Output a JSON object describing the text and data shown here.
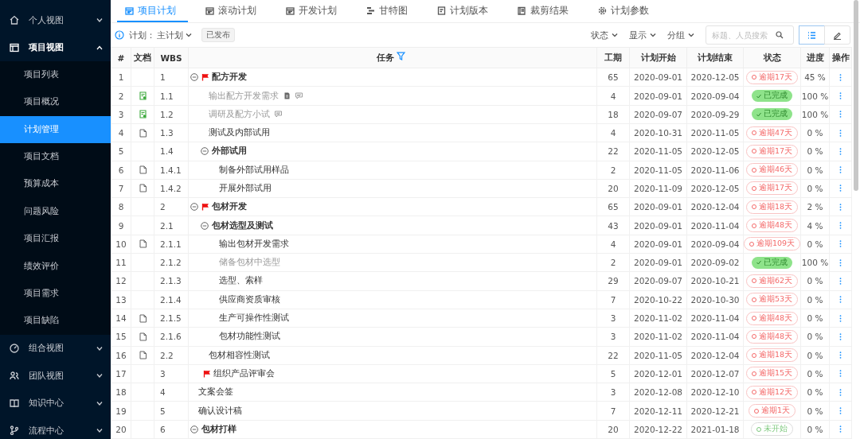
{
  "sidebar": {
    "groups": [
      {
        "label": "个人视图",
        "expanded": false
      },
      {
        "label": "项目视图",
        "expanded": true,
        "items": [
          {
            "label": "项目列表",
            "selected": false
          },
          {
            "label": "项目概况",
            "selected": false
          },
          {
            "label": "计划管理",
            "selected": true
          },
          {
            "label": "项目文档",
            "selected": false
          },
          {
            "label": "预算成本",
            "selected": false
          },
          {
            "label": "问题风险",
            "selected": false
          },
          {
            "label": "项目汇报",
            "selected": false
          },
          {
            "label": "绩效评价",
            "selected": false
          },
          {
            "label": "项目需求",
            "selected": false
          },
          {
            "label": "项目缺陷",
            "selected": false
          }
        ]
      },
      {
        "label": "组合视图",
        "expanded": false
      },
      {
        "label": "团队视图",
        "expanded": false
      },
      {
        "label": "知识中心",
        "expanded": false
      },
      {
        "label": "流程中心",
        "expanded": false
      }
    ]
  },
  "tabs": [
    {
      "label": "项目计划",
      "selected": true
    },
    {
      "label": "滚动计划",
      "selected": false
    },
    {
      "label": "开发计划",
      "selected": false
    },
    {
      "label": "甘特图",
      "selected": false
    },
    {
      "label": "计划版本",
      "selected": false
    },
    {
      "label": "裁剪结果",
      "selected": false
    },
    {
      "label": "计划参数",
      "selected": false
    }
  ],
  "toolbar": {
    "plan_label": "计划：",
    "plan": "主计划",
    "plan_status": "已发布",
    "filters": [
      "状态",
      "显示",
      "分组"
    ],
    "search": {
      "placeholder": "标题、人员搜索"
    },
    "views": [
      {
        "selected": true
      },
      {
        "selected": false
      }
    ]
  },
  "table": {
    "columns": [
      "#",
      "文档",
      "WBS",
      "任务",
      "工期",
      "计划开始",
      "计划结束",
      "状态",
      "进度",
      "操作"
    ],
    "rows": [
      {
        "num": "1",
        "document": false,
        "wbs": "1",
        "task": "配方开发",
        "flag": true,
        "note": false,
        "comment": false,
        "expanded": true,
        "duration": "65",
        "start": "2020-09-01",
        "end": "2020-12-05",
        "status": {
          "kind": "overdue",
          "label": "逾期17天"
        },
        "progress": "45 %",
        "children": [
          {
            "num": "2",
            "document": true,
            "document_checked": true,
            "wbs": "1.1",
            "task": "输出配方开发需求",
            "flag": false,
            "note": true,
            "comment": true,
            "duration": "4",
            "start": "2020-09-01",
            "end": "2020-09-04",
            "status": {
              "kind": "done",
              "label": "已完成"
            },
            "progress": "100 %"
          },
          {
            "num": "3",
            "document": true,
            "document_checked": true,
            "wbs": "1.2",
            "task": "调研及配方小试",
            "flag": false,
            "note": false,
            "comment": true,
            "duration": "18",
            "start": "2020-09-07",
            "end": "2020-09-29",
            "status": {
              "kind": "done",
              "label": "已完成"
            },
            "progress": "100 %"
          },
          {
            "num": "4",
            "document": true,
            "document_checked": false,
            "wbs": "1.3",
            "task": "测试及内部试用",
            "flag": false,
            "note": false,
            "comment": false,
            "duration": "4",
            "start": "2020-10-31",
            "end": "2020-11-05",
            "status": {
              "kind": "overdue",
              "label": "逾期47天"
            },
            "progress": "0 %"
          },
          {
            "num": "5",
            "document": false,
            "wbs": "1.4",
            "task": "外部试用",
            "flag": false,
            "note": false,
            "comment": false,
            "expanded": true,
            "duration": "22",
            "start": "2020-11-05",
            "end": "2020-12-05",
            "status": {
              "kind": "overdue",
              "label": "逾期17天"
            },
            "progress": "0 %",
            "children": [
              {
                "num": "6",
                "document": true,
                "document_checked": false,
                "wbs": "1.4.1",
                "task": "制备外部试用样品",
                "flag": false,
                "note": false,
                "comment": false,
                "duration": "2",
                "start": "2020-11-05",
                "end": "2020-11-06",
                "status": {
                  "kind": "overdue",
                  "label": "逾期46天"
                },
                "progress": "0 %"
              },
              {
                "num": "7",
                "document": true,
                "document_checked": false,
                "wbs": "1.4.2",
                "task": "开展外部试用",
                "flag": false,
                "note": false,
                "comment": false,
                "duration": "20",
                "start": "2020-11-09",
                "end": "2020-12-05",
                "status": {
                  "kind": "overdue",
                  "label": "逾期17天"
                },
                "progress": "0 %"
              }
            ]
          }
        ]
      },
      {
        "num": "8",
        "document": false,
        "wbs": "2",
        "task": "包材开发",
        "flag": true,
        "note": false,
        "comment": false,
        "expanded": true,
        "duration": "65",
        "start": "2020-09-01",
        "end": "2020-12-04",
        "status": {
          "kind": "overdue",
          "label": "逾期18天"
        },
        "progress": "2 %",
        "children": [
          {
            "num": "9",
            "document": false,
            "wbs": "2.1",
            "task": "包材选型及测试",
            "flag": false,
            "note": false,
            "comment": false,
            "expanded": true,
            "duration": "43",
            "start": "2020-09-01",
            "end": "2020-11-04",
            "status": {
              "kind": "overdue",
              "label": "逾期48天"
            },
            "progress": "4 %",
            "children": [
              {
                "num": "10",
                "document": true,
                "document_checked": false,
                "wbs": "2.1.1",
                "task": "输出包材开发需求",
                "flag": false,
                "note": false,
                "comment": false,
                "duration": "4",
                "start": "2020-09-01",
                "end": "2020-09-04",
                "status": {
                  "kind": "overdue",
                  "label": "逾期109天"
                },
                "progress": "0 %"
              },
              {
                "num": "11",
                "document": false,
                "wbs": "2.1.2",
                "task": "储备包材中选型",
                "flag": false,
                "note": false,
                "comment": false,
                "duration": "2",
                "start": "2020-09-01",
                "end": "2020-09-02",
                "status": {
                  "kind": "done",
                  "label": "已完成"
                },
                "progress": "100 %"
              },
              {
                "num": "12",
                "document": false,
                "wbs": "2.1.3",
                "task": "选型、索样",
                "flag": false,
                "note": false,
                "comment": false,
                "duration": "29",
                "start": "2020-09-07",
                "end": "2020-10-21",
                "status": {
                  "kind": "overdue",
                  "label": "逾期62天"
                },
                "progress": "0 %"
              },
              {
                "num": "13",
                "document": false,
                "wbs": "2.1.4",
                "task": "供应商资质审核",
                "flag": false,
                "note": false,
                "comment": false,
                "duration": "7",
                "start": "2020-10-22",
                "end": "2020-10-30",
                "status": {
                  "kind": "overdue",
                  "label": "逾期53天"
                },
                "progress": "0 %"
              },
              {
                "num": "14",
                "document": true,
                "document_checked": false,
                "wbs": "2.1.5",
                "task": "生产可操作性测试",
                "flag": false,
                "note": false,
                "comment": false,
                "duration": "3",
                "start": "2020-11-02",
                "end": "2020-11-04",
                "status": {
                  "kind": "overdue",
                  "label": "逾期48天"
                },
                "progress": "0 %"
              },
              {
                "num": "15",
                "document": true,
                "document_checked": false,
                "wbs": "2.1.6",
                "task": "包材功能性测试",
                "flag": false,
                "note": false,
                "comment": false,
                "duration": "3",
                "start": "2020-11-02",
                "end": "2020-11-04",
                "status": {
                  "kind": "overdue",
                  "label": "逾期48天"
                },
                "progress": "0 %"
              }
            ]
          },
          {
            "num": "16",
            "document": true,
            "document_checked": false,
            "wbs": "2.2",
            "task": "包材相容性测试",
            "flag": false,
            "note": false,
            "comment": false,
            "duration": "22",
            "start": "2020-11-05",
            "end": "2020-12-04",
            "status": {
              "kind": "overdue",
              "label": "逾期18天"
            },
            "progress": "0 %"
          }
        ]
      },
      {
        "num": "17",
        "document": false,
        "wbs": "3",
        "task": "组织产品评审会",
        "flag": true,
        "note": false,
        "comment": false,
        "duration": "5",
        "start": "2020-12-01",
        "end": "2020-12-07",
        "status": {
          "kind": "overdue",
          "label": "逾期15天"
        },
        "progress": "0 %"
      },
      {
        "num": "18",
        "document": false,
        "wbs": "4",
        "task": "文案会签",
        "flag": false,
        "note": false,
        "comment": false,
        "duration": "3",
        "start": "2020-12-08",
        "end": "2020-12-10",
        "status": {
          "kind": "overdue",
          "label": "逾期12天"
        },
        "progress": "0 %"
      },
      {
        "num": "19",
        "document": false,
        "wbs": "5",
        "task": "确认设计稿",
        "flag": false,
        "note": false,
        "comment": false,
        "duration": "7",
        "start": "2020-12-11",
        "end": "2020-12-21",
        "status": {
          "kind": "overdue",
          "label": "逾期1天"
        },
        "progress": "0 %"
      },
      {
        "num": "20",
        "document": false,
        "wbs": "6",
        "task": "包材打样",
        "flag": false,
        "note": false,
        "comment": false,
        "expanded": true,
        "duration": "20",
        "start": "2020-12-22",
        "end": "2021-01-18",
        "status": {
          "kind": "pending",
          "label": "未开始"
        },
        "progress": "0 %"
      }
    ]
  }
}
